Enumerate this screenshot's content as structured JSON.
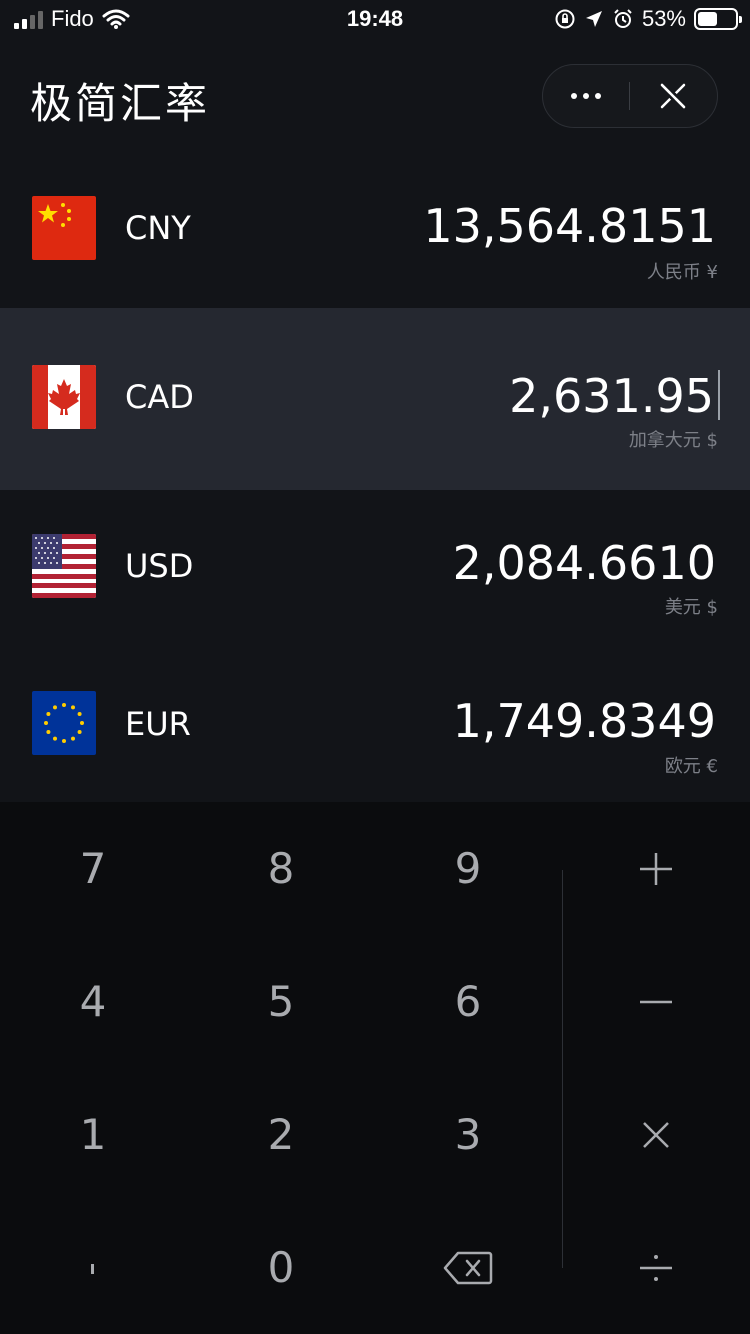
{
  "status_bar": {
    "carrier": "Fido",
    "time": "19:48",
    "battery_percent": "53%",
    "battery_level": 0.53
  },
  "header": {
    "title": "极简汇率",
    "more_icon": "more-dots-icon",
    "close_icon": "close-icon"
  },
  "currencies": [
    {
      "code": "CNY",
      "amount": "13,564.8151",
      "subtitle": "人民币 ¥",
      "flag": "china-flag-icon",
      "active": false
    },
    {
      "code": "CAD",
      "amount": "2,631.95",
      "subtitle": "加拿大元 $",
      "flag": "canada-flag-icon",
      "active": true
    },
    {
      "code": "USD",
      "amount": "2,084.6610",
      "subtitle": "美元 $",
      "flag": "usa-flag-icon",
      "active": false
    },
    {
      "code": "EUR",
      "amount": "1,749.8349",
      "subtitle": "欧元 €",
      "flag": "eu-flag-icon",
      "active": false
    }
  ],
  "colors": {
    "background": "#121418",
    "active_row": "#252830",
    "keypad_bg": "#0b0c0e",
    "key_text": "#a9abaf",
    "subtitle": "#7d8088"
  },
  "keypad": {
    "keys": [
      "7",
      "8",
      "9",
      "4",
      "5",
      "6",
      "1",
      "2",
      "3",
      "0"
    ],
    "decimal_key": ".",
    "backspace_icon": "backspace-icon",
    "operators": [
      "plus-icon",
      "minus-icon",
      "multiply-icon",
      "divide-icon"
    ]
  }
}
